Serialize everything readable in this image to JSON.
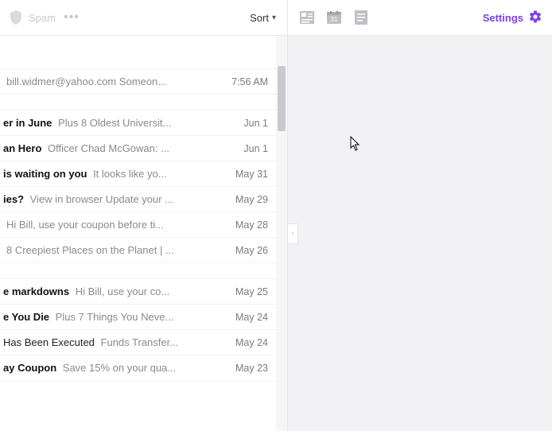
{
  "colors": {
    "accent": "#7b3ff2"
  },
  "toolbar": {
    "folder": "Spam",
    "moreTooltip": "More",
    "sort": "Sort"
  },
  "rightbar": {
    "settings": "Settings"
  },
  "messages": [
    {
      "subject": "",
      "preview": "bill.widmer@yahoo.com Someon...",
      "date": "7:56 AM",
      "unread": false,
      "spacerBefore": 42
    },
    {
      "subject": "er in June",
      "preview": "Plus 8 Oldest Universit...",
      "date": "Jun 1",
      "unread": true,
      "spacerBefore": 20
    },
    {
      "subject": "an Hero",
      "preview": "Officer Chad McGowan: ...",
      "date": "Jun 1",
      "unread": true,
      "spacerBefore": 0
    },
    {
      "subject": "is waiting on you",
      "preview": "It looks like yo...",
      "date": "May 31",
      "unread": true,
      "spacerBefore": 0
    },
    {
      "subject": "ies?",
      "preview": "View in browser Update your ...",
      "date": "May 29",
      "unread": true,
      "spacerBefore": 0
    },
    {
      "subject": "",
      "preview": "Hi Bill, use your coupon before ti...",
      "date": "May 28",
      "unread": false,
      "spacerBefore": 0
    },
    {
      "subject": "",
      "preview": "8 Creepiest Places on the Planet | ...",
      "date": "May 26",
      "unread": false,
      "spacerBefore": 0
    },
    {
      "subject": "e markdowns",
      "preview": "Hi Bill, use your co...",
      "date": "May 25",
      "unread": true,
      "spacerBefore": 20
    },
    {
      "subject": "e You Die",
      "preview": "Plus 7 Things You Neve...",
      "date": "May 24",
      "unread": true,
      "spacerBefore": 0
    },
    {
      "subject": "Has Been Executed",
      "preview": "Funds Transfer...",
      "date": "May 24",
      "unread": false,
      "spacerBefore": 0
    },
    {
      "subject": "ay Coupon",
      "preview": "Save 15% on your qua...",
      "date": "May 23",
      "unread": true,
      "spacerBefore": 0
    }
  ]
}
